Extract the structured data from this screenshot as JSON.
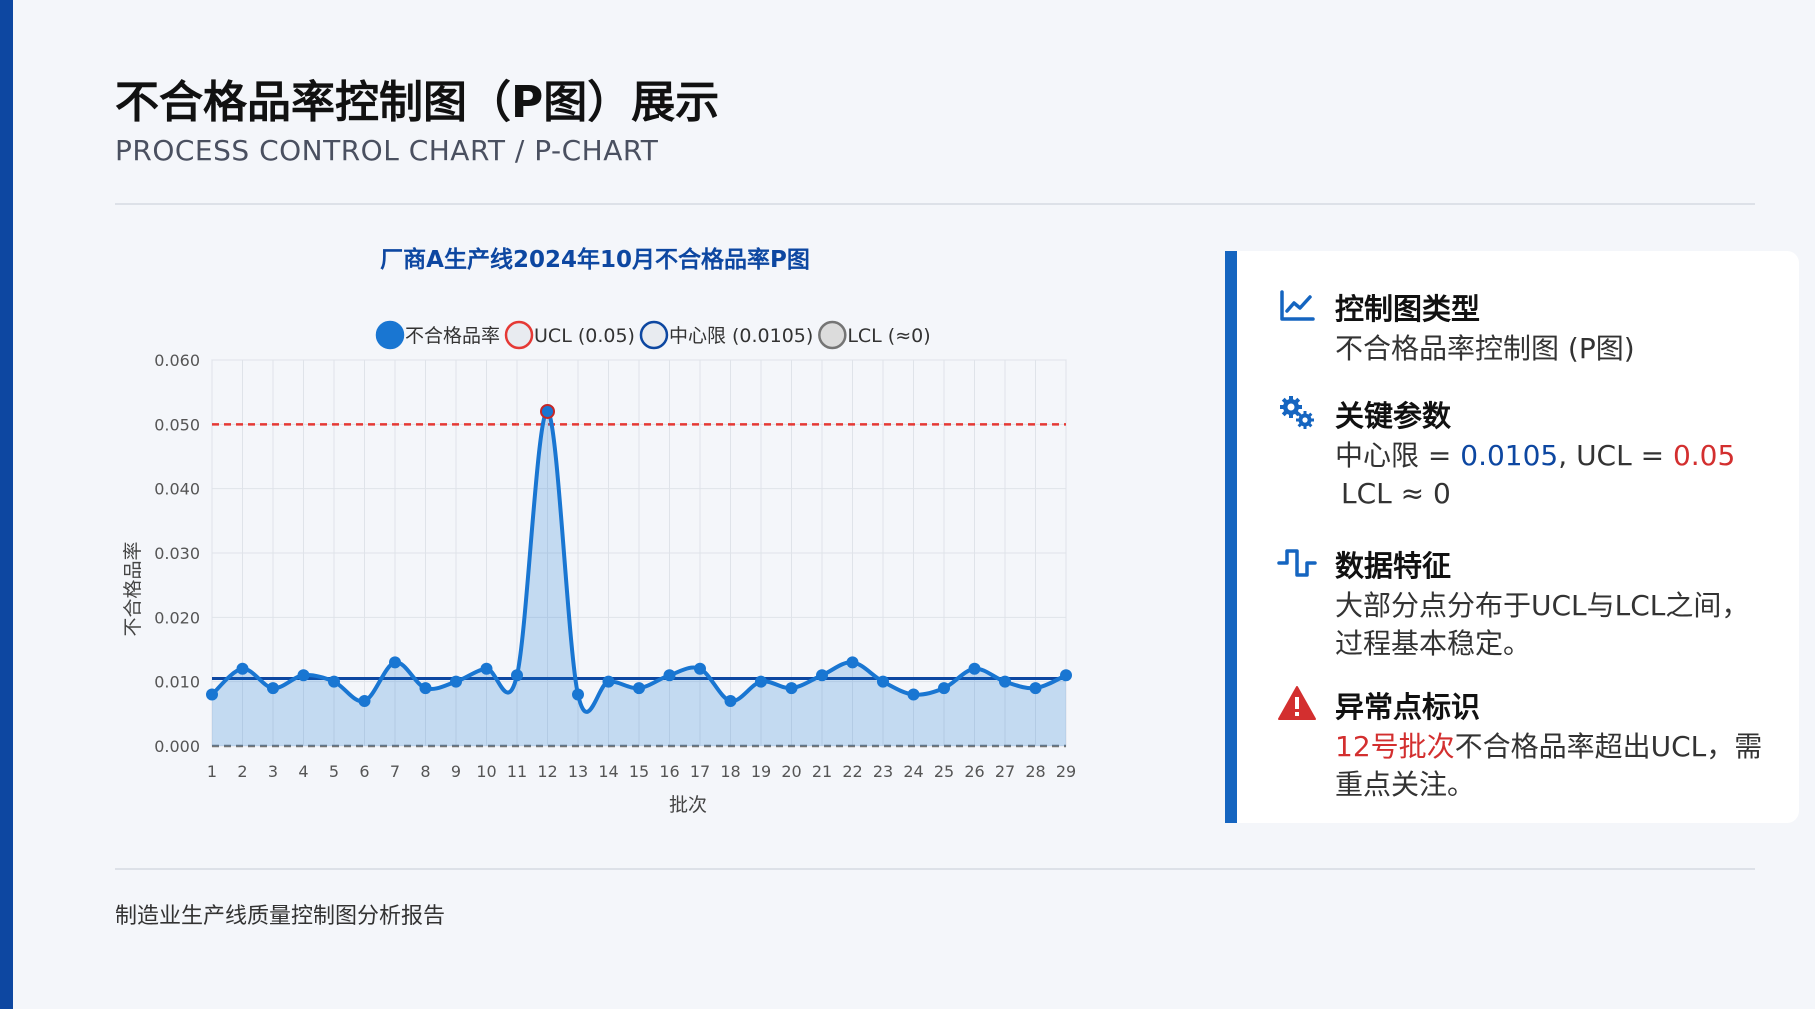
{
  "page": {
    "title": "不合格品率控制图（P图）展示",
    "subtitle": "PROCESS CONTROL CHART / P-CHART",
    "footer": "制造业生产线质量控制图分析报告"
  },
  "colors": {
    "accent": "#0d47a1",
    "series": "#1976d2",
    "ucl": "#e53935",
    "center": "#0d47a1",
    "lcl": "#757575",
    "alert": "#d32f2f"
  },
  "chart_data": {
    "type": "line",
    "title": "厂商A生产线2024年10月不合格品率P图",
    "xlabel": "批次",
    "ylabel": "不合格品率",
    "ylim": [
      0,
      0.06
    ],
    "yticks": [
      "0.000",
      "0.010",
      "0.020",
      "0.030",
      "0.040",
      "0.050",
      "0.060"
    ],
    "x": [
      1,
      2,
      3,
      4,
      5,
      6,
      7,
      8,
      9,
      10,
      11,
      12,
      13,
      14,
      15,
      16,
      17,
      18,
      19,
      20,
      21,
      22,
      23,
      24,
      25,
      26,
      27,
      28,
      29
    ],
    "legend_position": "top",
    "grid": true,
    "series": [
      {
        "name": "不合格品率",
        "values": [
          0.008,
          0.012,
          0.009,
          0.011,
          0.01,
          0.007,
          0.013,
          0.009,
          0.01,
          0.012,
          0.011,
          0.052,
          0.008,
          0.01,
          0.009,
          0.011,
          0.012,
          0.007,
          0.01,
          0.009,
          0.011,
          0.013,
          0.01,
          0.008,
          0.009,
          0.012,
          0.01,
          0.009,
          0.011
        ],
        "fill": true,
        "highlight_index": 11
      }
    ],
    "reference_lines": [
      {
        "name": "UCL (0.05)",
        "value": 0.05,
        "style": "dashed",
        "color": "#e53935"
      },
      {
        "name": "中心限 (0.0105)",
        "value": 0.0105,
        "style": "solid",
        "color": "#0d47a1"
      },
      {
        "name": "LCL (≈0)",
        "value": 0,
        "style": "dashed",
        "color": "#757575"
      }
    ]
  },
  "info": {
    "type": {
      "icon": "line-chart-icon",
      "heading": "控制图类型",
      "text": "不合格品率控制图 (P图)"
    },
    "params": {
      "icon": "gears-icon",
      "heading": "关键参数",
      "center_label": "中心限 = ",
      "center_value": "0.0105",
      "sep": ", ",
      "ucl_label": "UCL = ",
      "ucl_value": "0.05",
      "lcl_text": "LCL ≈ 0"
    },
    "features": {
      "icon": "wave-square-icon",
      "heading": "数据特征",
      "text": "大部分点分布于UCL与LCL之间，过程基本稳定。"
    },
    "anomaly": {
      "icon": "warning-icon",
      "heading": "异常点标识",
      "highlight": "12号批次",
      "text": "不合格品率超出UCL，需重点关注。"
    }
  }
}
